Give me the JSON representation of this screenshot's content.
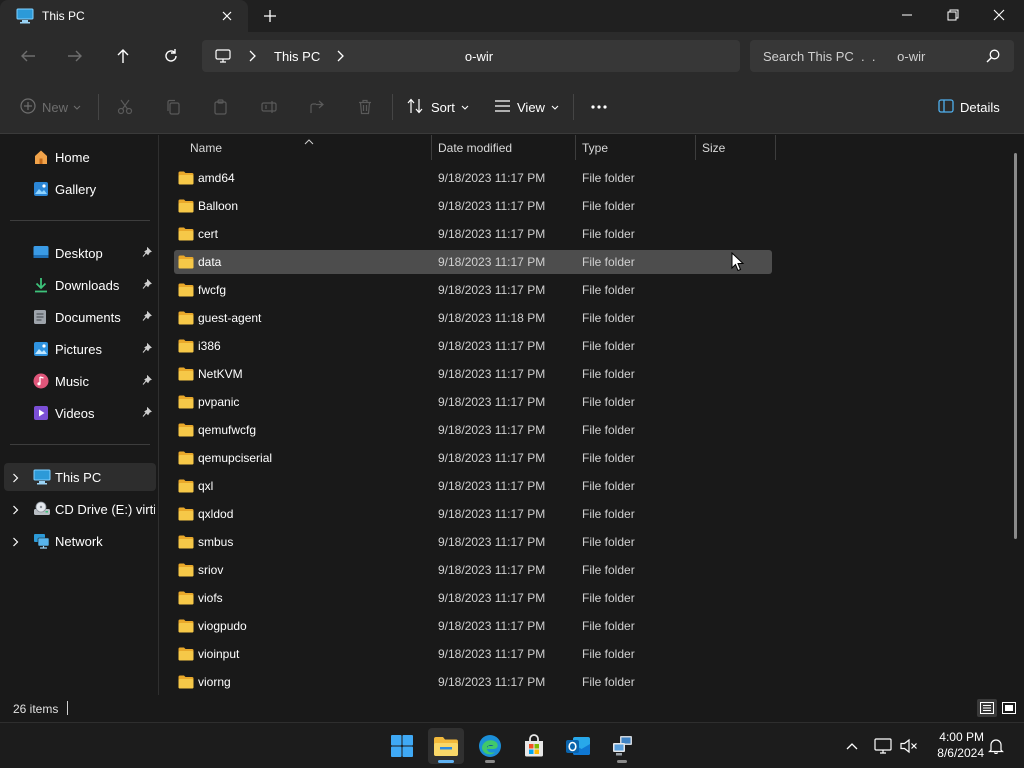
{
  "window": {
    "tab_title": "This PC",
    "tab_icon": "this-pc-icon",
    "new_tab_icon": "plus-icon",
    "controls": [
      "minimize-icon",
      "maximize-icon",
      "close-icon"
    ]
  },
  "address_bar": {
    "back_icon": "arrow-left-icon",
    "forward_icon": "arrow-right-icon",
    "up_icon": "arrow-up-icon",
    "refresh_icon": "refresh-icon",
    "crumbs": [
      "This PC",
      "o-wir"
    ],
    "search_text": "Search This PC  .  .      o-wir"
  },
  "command_bar": {
    "new_label": "New",
    "sort_label": "Sort",
    "view_label": "View",
    "details_label": "Details",
    "disabled_icons": [
      "cut-icon",
      "copy-icon",
      "paste-icon",
      "rename-icon",
      "share-icon",
      "delete-icon"
    ]
  },
  "nav": {
    "quick": [
      {
        "label": "Home",
        "icon": "home-icon",
        "pinned": false
      },
      {
        "label": "Gallery",
        "icon": "gallery-icon",
        "pinned": false
      }
    ],
    "pinned": [
      {
        "label": "Desktop",
        "icon": "desktop-icon"
      },
      {
        "label": "Downloads",
        "icon": "downloads-icon"
      },
      {
        "label": "Documents",
        "icon": "documents-icon"
      },
      {
        "label": "Pictures",
        "icon": "pictures-icon"
      },
      {
        "label": "Music",
        "icon": "music-icon"
      },
      {
        "label": "Videos",
        "icon": "videos-icon"
      }
    ],
    "locations": [
      {
        "label": "This PC",
        "icon": "this-pc-icon",
        "selected": true
      },
      {
        "label": "CD Drive (E:) virtio-",
        "icon": "cd-drive-icon",
        "selected": false
      },
      {
        "label": "Network",
        "icon": "network-icon",
        "selected": false
      }
    ]
  },
  "columns": {
    "name": "Name",
    "date": "Date modified",
    "type": "Type",
    "size": "Size"
  },
  "files": [
    {
      "name": "amd64",
      "date": "9/18/2023 11:17 PM",
      "type": "File folder",
      "highlighted": false
    },
    {
      "name": "Balloon",
      "date": "9/18/2023 11:17 PM",
      "type": "File folder",
      "highlighted": false
    },
    {
      "name": "cert",
      "date": "9/18/2023 11:17 PM",
      "type": "File folder",
      "highlighted": false
    },
    {
      "name": "data",
      "date": "9/18/2023 11:17 PM",
      "type": "File folder",
      "highlighted": true
    },
    {
      "name": "fwcfg",
      "date": "9/18/2023 11:17 PM",
      "type": "File folder",
      "highlighted": false
    },
    {
      "name": "guest-agent",
      "date": "9/18/2023 11:18 PM",
      "type": "File folder",
      "highlighted": false
    },
    {
      "name": "i386",
      "date": "9/18/2023 11:17 PM",
      "type": "File folder",
      "highlighted": false
    },
    {
      "name": "NetKVM",
      "date": "9/18/2023 11:17 PM",
      "type": "File folder",
      "highlighted": false
    },
    {
      "name": "pvpanic",
      "date": "9/18/2023 11:17 PM",
      "type": "File folder",
      "highlighted": false
    },
    {
      "name": "qemufwcfg",
      "date": "9/18/2023 11:17 PM",
      "type": "File folder",
      "highlighted": false
    },
    {
      "name": "qemupciserial",
      "date": "9/18/2023 11:17 PM",
      "type": "File folder",
      "highlighted": false
    },
    {
      "name": "qxl",
      "date": "9/18/2023 11:17 PM",
      "type": "File folder",
      "highlighted": false
    },
    {
      "name": "qxldod",
      "date": "9/18/2023 11:17 PM",
      "type": "File folder",
      "highlighted": false
    },
    {
      "name": "smbus",
      "date": "9/18/2023 11:17 PM",
      "type": "File folder",
      "highlighted": false
    },
    {
      "name": "sriov",
      "date": "9/18/2023 11:17 PM",
      "type": "File folder",
      "highlighted": false
    },
    {
      "name": "viofs",
      "date": "9/18/2023 11:17 PM",
      "type": "File folder",
      "highlighted": false
    },
    {
      "name": "viogpudo",
      "date": "9/18/2023 11:17 PM",
      "type": "File folder",
      "highlighted": false
    },
    {
      "name": "vioinput",
      "date": "9/18/2023 11:17 PM",
      "type": "File folder",
      "highlighted": false
    },
    {
      "name": "viorng",
      "date": "9/18/2023 11:17 PM",
      "type": "File folder",
      "highlighted": false
    }
  ],
  "status": {
    "item_count": "26 items",
    "view_icons": [
      "details-view-icon",
      "large-icons-view-icon"
    ]
  },
  "taskbar": {
    "apps": [
      "start-icon",
      "file-explorer-icon",
      "edge-icon",
      "store-icon",
      "outlook-icon",
      "network-share-app-icon"
    ],
    "tray_icons": [
      "chevron-up-icon",
      "display-icon",
      "volume-muted-icon"
    ],
    "time": "4:00 PM",
    "date": "8/6/2024",
    "notification_icon": "bell-icon"
  },
  "colors": {
    "background": "#191919",
    "chrome": "#2b2b2b",
    "folder": "#f4c34a",
    "accent": "#5fb2f2"
  }
}
